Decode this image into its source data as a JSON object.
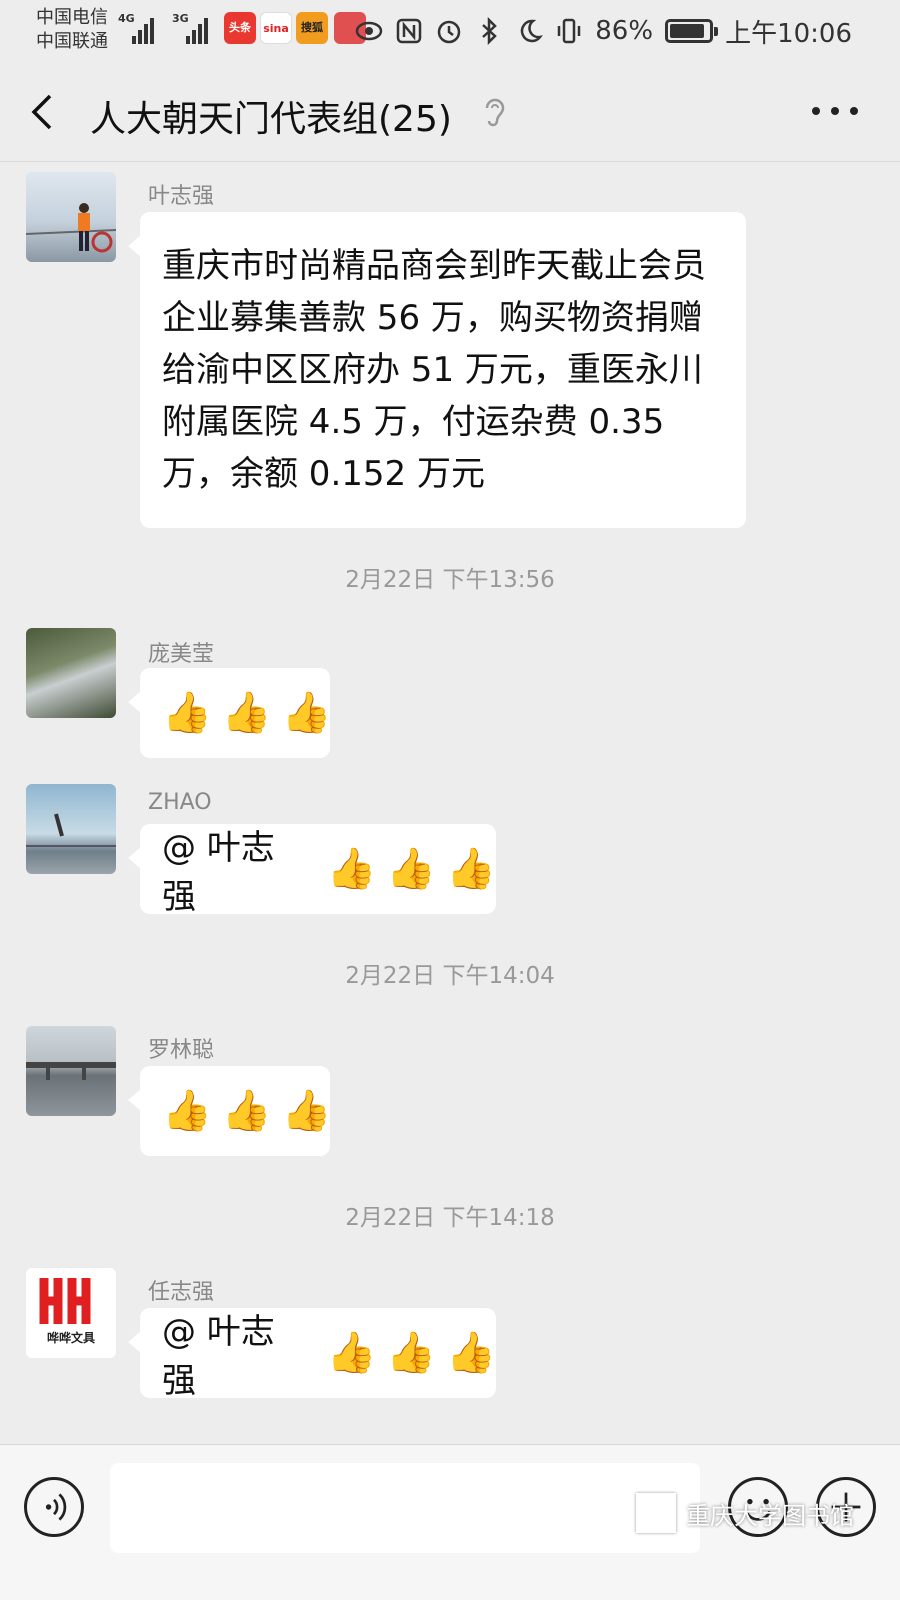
{
  "status_bar": {
    "carrier_1": "中国电信",
    "carrier_2": "中国联通",
    "net_1": "4G",
    "net_2": "3G",
    "apps": [
      {
        "label": "头条",
        "icon": "toutiao-app-icon",
        "color": "#e8382f"
      },
      {
        "label": "sina",
        "icon": "sina-app-icon",
        "color": "#ffffff"
      },
      {
        "label": "搜狐",
        "icon": "sohu-app-icon",
        "color": "#f29c1f"
      },
      {
        "label": "",
        "icon": "news-app-icon",
        "color": "#e05050"
      }
    ],
    "battery": "86%",
    "battery_level": 0.86,
    "time": "上午10:06"
  },
  "header": {
    "title": "人大朝天门代表组(25)"
  },
  "messages": [
    {
      "sender": "叶志强",
      "text": "重庆市时尚精品商会到昨天截止会员企业募集善款 56 万，购买物资捐赠给渝中区区府办 51 万元，重医永川附属医院 4.5 万，付运杂费 0.35 万，余额 0.152 万元"
    },
    {
      "timestamp": "2月22日 下午13:56"
    },
    {
      "sender": "庞美莹",
      "emojis": [
        "👍",
        "👍",
        "👍"
      ]
    },
    {
      "sender": "ZHAO",
      "mention": "@ 叶志强",
      "emojis": [
        "👍",
        "👍",
        "👍"
      ]
    },
    {
      "timestamp": "2月22日 下午14:04"
    },
    {
      "sender": "罗林聪",
      "emojis": [
        "👍",
        "👍",
        "👍"
      ]
    },
    {
      "timestamp": "2月22日 下午14:18"
    },
    {
      "sender": "任志强",
      "mention": "@ 叶志强",
      "emojis": [
        "👍",
        "👍",
        "👍"
      ],
      "avatar_text": "哗哗文具"
    }
  ],
  "input_bar": {
    "watermark": "重庆大学图书馆"
  },
  "colors": {
    "background": "#ededed",
    "bubble": "#ffffff",
    "timestamp": "#999999",
    "sender": "#888888"
  }
}
